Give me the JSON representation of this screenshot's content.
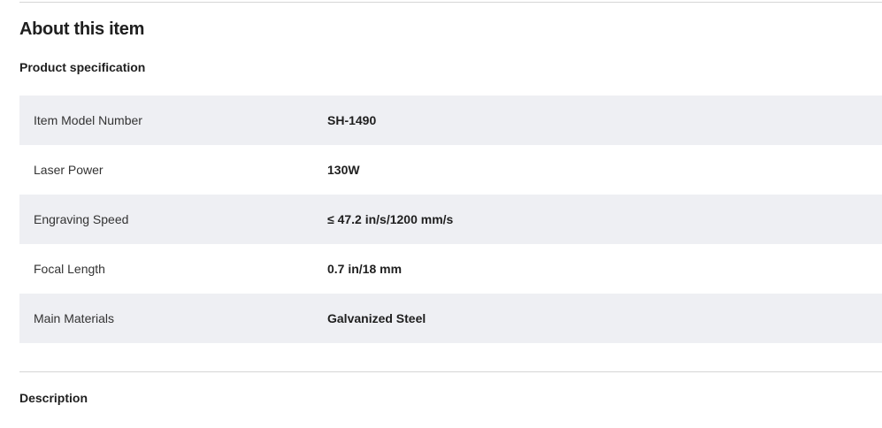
{
  "section": {
    "title": "About this item",
    "spec_heading": "Product specification",
    "description_heading": "Description"
  },
  "specs": [
    {
      "label": "Item Model Number",
      "value": "SH-1490"
    },
    {
      "label": "Laser Power",
      "value": "130W"
    },
    {
      "label": "Engraving Speed",
      "value": "≤ 47.2 in/s/1200 mm/s"
    },
    {
      "label": "Focal Length",
      "value": "0.7 in/18 mm"
    },
    {
      "label": "Main Materials",
      "value": "Galvanized Steel"
    }
  ],
  "colors": {
    "row_shade": "#eeeff3",
    "divider": "#d6d6d6",
    "text": "#1f1f1f"
  }
}
